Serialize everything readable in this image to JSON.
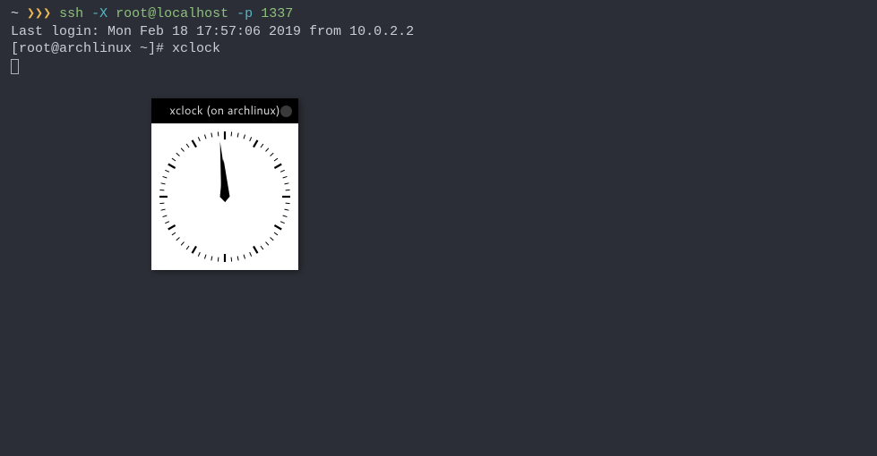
{
  "terminal": {
    "line1": {
      "tilde": "~ ",
      "arrows": "❯❯❯ ",
      "cmd": "ssh ",
      "flag": "-X",
      "rest": " root@localhost ",
      "flag2": "-p",
      "port": " 1337"
    },
    "line2": "Last login: Mon Feb 18 17:57:06 2019 from 10.0.2.2",
    "line3": {
      "prompt": "[root@archlinux ~]# ",
      "cmd": "xclock"
    }
  },
  "xclock": {
    "title": "xclock (on archlinux)"
  },
  "clock_time": {
    "hour_angle": 358,
    "minute_angle": 355
  }
}
